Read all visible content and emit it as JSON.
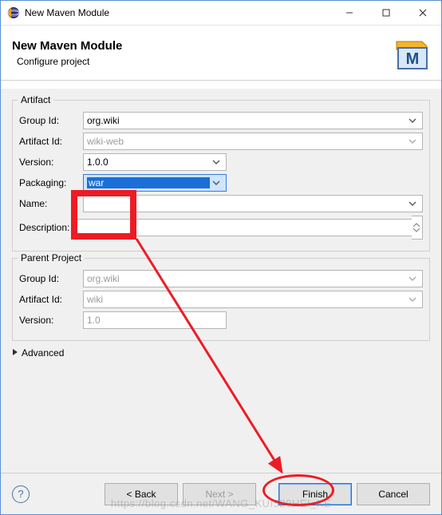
{
  "window": {
    "title": "New Maven Module"
  },
  "banner": {
    "title": "New Maven Module",
    "subtitle": "Configure project"
  },
  "artifact": {
    "legend": "Artifact",
    "group_id_label": "Group Id:",
    "group_id_value": "org.wiki",
    "artifact_id_label": "Artifact Id:",
    "artifact_id_value": "wiki-web",
    "version_label": "Version:",
    "version_value": "1.0.0",
    "packaging_label": "Packaging:",
    "packaging_value": "war",
    "name_label": "Name:",
    "name_value": "",
    "description_label": "Description:",
    "description_value": ""
  },
  "parent": {
    "legend": "Parent Project",
    "group_id_label": "Group Id:",
    "group_id_value": "org.wiki",
    "artifact_id_label": "Artifact Id:",
    "artifact_id_value": "wiki",
    "version_label": "Version:",
    "version_value": "1.0"
  },
  "advanced_label": "Advanced",
  "footer": {
    "back": "< Back",
    "next": "Next >",
    "finish": "Finish",
    "cancel": "Cancel"
  },
  "colors": {
    "annotation_red": "#ed1c24"
  },
  "watermark": "https://blog.csdn.net/WANG_KUI520HEI_KE"
}
